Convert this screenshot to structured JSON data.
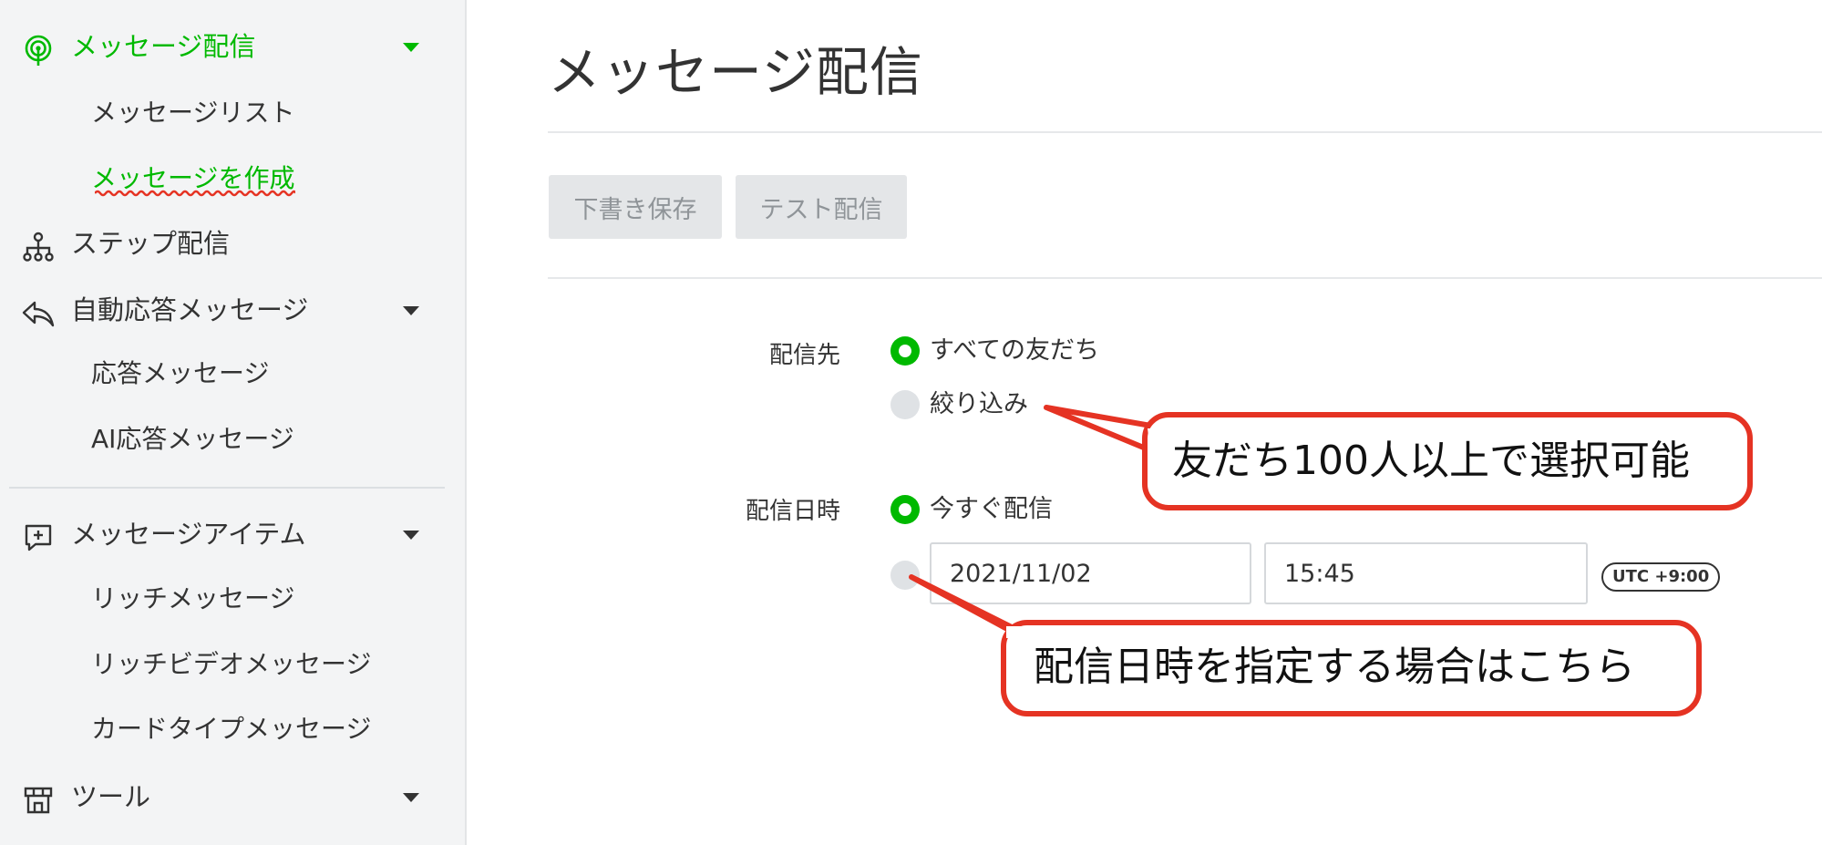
{
  "sidebar": {
    "sections": [
      {
        "label": "メッセージ配信",
        "icon": "broadcast-icon",
        "expanded": true,
        "active": true,
        "children": [
          {
            "label": "メッセージリスト"
          },
          {
            "label": "メッセージを作成",
            "active": true
          }
        ]
      },
      {
        "label": "ステップ配信",
        "icon": "step-flow-icon"
      },
      {
        "label": "自動応答メッセージ",
        "icon": "reply-icon",
        "expanded": true,
        "children": [
          {
            "label": "応答メッセージ"
          },
          {
            "label": "AI応答メッセージ"
          }
        ]
      },
      {
        "label": "メッセージアイテム",
        "icon": "message-add-icon",
        "expanded": true,
        "children": [
          {
            "label": "リッチメッセージ"
          },
          {
            "label": "リッチビデオメッセージ"
          },
          {
            "label": "カードタイプメッセージ"
          }
        ]
      },
      {
        "label": "ツール",
        "icon": "shop-icon",
        "expanded": true
      }
    ]
  },
  "page": {
    "title": "メッセージ配信"
  },
  "toolbar": {
    "save_draft_label": "下書き保存",
    "test_send_label": "テスト配信"
  },
  "form": {
    "recipients": {
      "label": "配信先",
      "options": [
        {
          "label": "すべての友だち",
          "selected": true
        },
        {
          "label": "絞り込み",
          "selected": false
        }
      ]
    },
    "schedule": {
      "label": "配信日時",
      "options": [
        {
          "label": "今すぐ配信",
          "selected": true
        },
        {
          "label": "",
          "selected": false
        }
      ],
      "date_value": "2021/11/02",
      "time_value": "15:45",
      "timezone": "UTC +9:00"
    }
  },
  "annotations": [
    {
      "text": "友だち100人以上で選択可能"
    },
    {
      "text": "配信日時を指定する場合はこちら"
    }
  ],
  "colors": {
    "brand_green": "#00b900",
    "annotation_red": "#e53323",
    "sidebar_bg": "#f3f4f5"
  }
}
